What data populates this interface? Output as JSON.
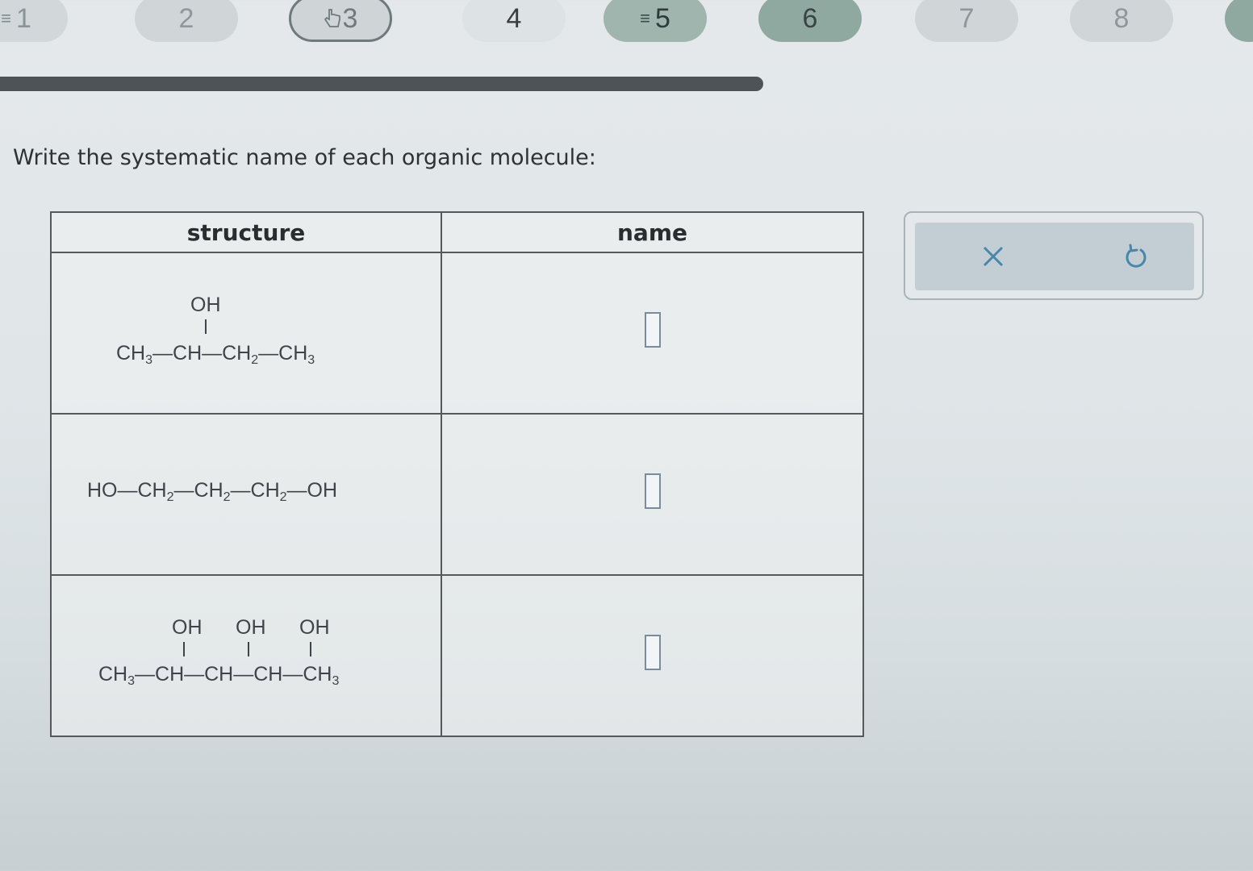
{
  "nav": {
    "questions": [
      {
        "label": "1",
        "state": "done"
      },
      {
        "label": "2",
        "state": "gray"
      },
      {
        "label": "3",
        "state": "current"
      },
      {
        "label": "4",
        "state": "plain"
      },
      {
        "label": "5",
        "state": "flag"
      },
      {
        "label": "6",
        "state": "flag2"
      },
      {
        "label": "7",
        "state": "gray"
      },
      {
        "label": "8",
        "state": "gray"
      }
    ]
  },
  "prompt": "Write the systematic name of each organic molecule:",
  "table": {
    "headers": [
      "structure",
      "name"
    ],
    "rows": [
      {
        "substituents": [
          "OH"
        ],
        "chain": [
          {
            "text": "CH",
            "sub": "3"
          },
          {
            "text": "CH",
            "sub": ""
          },
          {
            "text": "CH",
            "sub": "2"
          },
          {
            "text": "CH",
            "sub": "3"
          }
        ],
        "name_value": ""
      },
      {
        "chain": [
          {
            "text": "HO",
            "sub": ""
          },
          {
            "text": "CH",
            "sub": "2"
          },
          {
            "text": "CH",
            "sub": "2"
          },
          {
            "text": "CH",
            "sub": "2"
          },
          {
            "text": "OH",
            "sub": ""
          }
        ],
        "name_value": ""
      },
      {
        "substituents": [
          "OH",
          "OH",
          "OH"
        ],
        "chain": [
          {
            "text": "CH",
            "sub": "3"
          },
          {
            "text": "CH",
            "sub": ""
          },
          {
            "text": "CH",
            "sub": ""
          },
          {
            "text": "CH",
            "sub": ""
          },
          {
            "text": "CH",
            "sub": "3"
          }
        ],
        "name_value": ""
      }
    ]
  },
  "actions": {
    "clear_icon": "close-icon",
    "undo_icon": "undo-icon",
    "icon_color": "#4a86a8"
  },
  "colors": {
    "progress": "#4d5356",
    "border": "#56595c",
    "answer_box": "#7a8b9c"
  }
}
